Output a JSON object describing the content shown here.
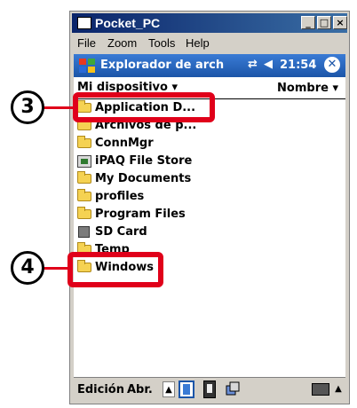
{
  "window": {
    "title": "Pocket_PC",
    "min_label": "_",
    "max_label": "□",
    "close_label": "×"
  },
  "menu": {
    "file": "File",
    "zoom": "Zoom",
    "tools": "Tools",
    "help": "Help"
  },
  "pda": {
    "title": "Explorador de arch",
    "clock": "21:54",
    "conn_icon": "⇄",
    "vol_icon": "◀",
    "close_label": "✕",
    "folder_selector": "Mi dispositivo ▾",
    "sort_label": "Nombre ▾"
  },
  "items": [
    {
      "label": "Application D...",
      "icon": "folder"
    },
    {
      "label": "Archivos de p...",
      "icon": "folder"
    },
    {
      "label": "ConnMgr",
      "icon": "folder"
    },
    {
      "label": "iPAQ File Store",
      "icon": "ipaq-storage"
    },
    {
      "label": "My Documents",
      "icon": "folder"
    },
    {
      "label": "profiles",
      "icon": "folder"
    },
    {
      "label": "Program Files",
      "icon": "folder"
    },
    {
      "label": "SD Card",
      "icon": "sd-card"
    },
    {
      "label": "Temp",
      "icon": "folder"
    },
    {
      "label": "Windows",
      "icon": "folder"
    }
  ],
  "bottom": {
    "edit": "Edición",
    "open": "Abr.",
    "up_arrow": "▲",
    "kbd_arrow": "▲"
  },
  "callouts": [
    {
      "number": "3"
    },
    {
      "number": "4"
    }
  ],
  "colors": {
    "callout_red": "#e0001a",
    "title_blue": "#1b55a8"
  }
}
